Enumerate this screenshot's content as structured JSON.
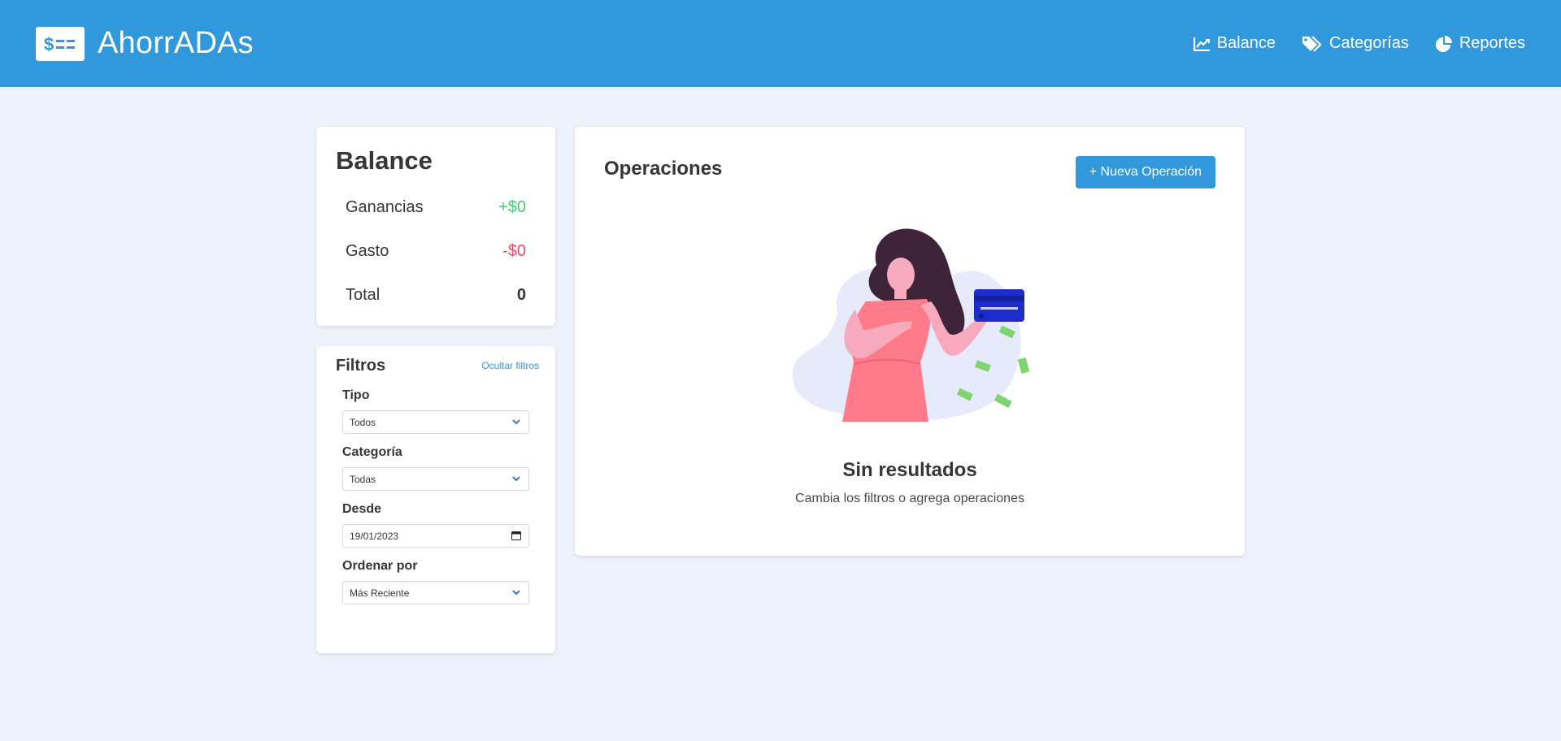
{
  "navbar": {
    "brand": "AhorrADAs",
    "logo_icon": "dollar-lines-icon",
    "links": [
      {
        "label": "Balance",
        "icon": "chart-line-icon"
      },
      {
        "label": "Categorías",
        "icon": "tags-icon"
      },
      {
        "label": "Reportes",
        "icon": "chart-pie-icon"
      }
    ],
    "color": "#3298dc"
  },
  "balance": {
    "title": "Balance",
    "rows": [
      {
        "label": "Ganancias",
        "value": "+$0"
      },
      {
        "label": "Gasto",
        "value": "-$0"
      },
      {
        "label": "Total",
        "value": "0"
      }
    ],
    "positive_color": "#48c774",
    "negative_color": "#f14668"
  },
  "filters": {
    "title": "Filtros",
    "toggle_label": "Ocultar filtros",
    "fields": [
      {
        "label": "Tipo",
        "value": "Todos"
      },
      {
        "label": "Categoría",
        "value": "Todas"
      },
      {
        "label": "Desde",
        "value": "19/01/2023"
      },
      {
        "label": "Ordenar por",
        "value": "Más Reciente"
      }
    ]
  },
  "operations": {
    "title": "Operaciones",
    "new_button": "+ Nueva Operación",
    "empty_title": "Sin resultados",
    "empty_subtitle": "Cambia los filtros o agrega operaciones"
  }
}
